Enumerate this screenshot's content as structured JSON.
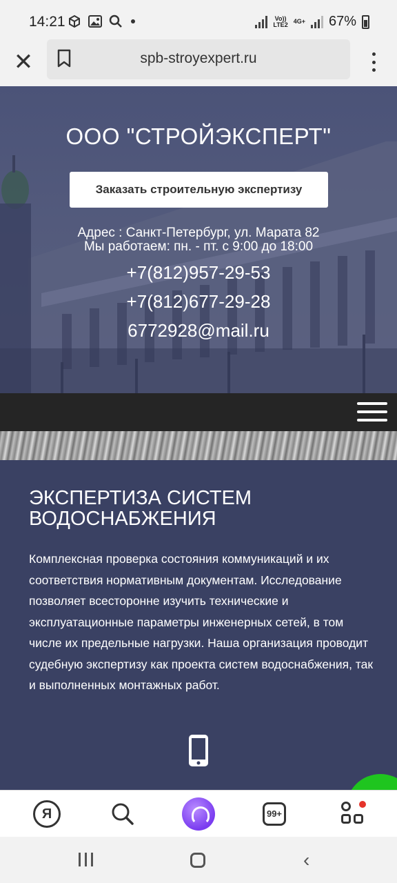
{
  "status_bar": {
    "time": "14:21",
    "battery": "67%",
    "network_top": "Vo))",
    "network_bottom": "LTE2",
    "network2": "4G+",
    "icons": [
      "box-icon",
      "image-icon",
      "search-icon",
      "dot-icon",
      "signal-icon",
      "battery-icon"
    ]
  },
  "browser": {
    "url": "spb-stroyexpert.ru",
    "icons": [
      "close-icon",
      "bookmark-icon",
      "more-vert-icon"
    ]
  },
  "hero": {
    "title": "ООО \"СТРОЙЭКСПЕРТ\"",
    "cta": "Заказать строительную экспертизу",
    "address": "Адрес : Санкт-Петербург, ул. Марата 82",
    "hours": "Мы работаем: пн. - пт. с 9:00 до 18:00",
    "phone1": "+7(812)957-29-53",
    "phone2": "+7(812)677-29-28",
    "email": "6772928@mail.ru"
  },
  "section": {
    "title": "ЭКСПЕРТИЗА СИСТЕМ ВОДОСНАБЖЕНИЯ",
    "text": "Комплексная проверка состояния коммуникаций и их соответствия нормативным документам. Исследование позволяет всесторонне изучить технические и эксплуатационные параметры инженерных сетей, в том числе их предельные нагрузки. Наша организация проводит судебную экспертизу как проекта систем водоснабжения, так и выполненных монтажных работ."
  },
  "toolbar": {
    "yandex_label": "Я",
    "tabs_count": "99+",
    "icons": [
      "yandex-icon",
      "search-icon",
      "alice-icon",
      "tabs-icon",
      "apps-icon"
    ]
  },
  "colors": {
    "content_bg": "#3a4163",
    "nav_bg": "#252525",
    "alice": "#7a3cf0",
    "fab": "#1fc51f"
  }
}
